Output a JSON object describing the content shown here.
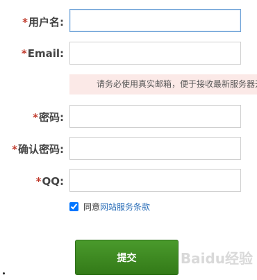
{
  "form": {
    "required_mark": "*",
    "username": {
      "label": "用户名:",
      "value": ""
    },
    "email": {
      "label": "Email:",
      "value": ""
    },
    "hint": "请务必使用真实邮箱，便于接收最新服务器开",
    "password": {
      "label": "密码:",
      "value": ""
    },
    "confirm_password": {
      "label": "确认密码:",
      "value": ""
    },
    "qq": {
      "label": "QQ:",
      "value": ""
    },
    "agree": {
      "prefix": "同意",
      "terms_link": "网站服务条款",
      "checked": true
    },
    "submit_label": "提交"
  },
  "watermark": {
    "text": "Baidu经验"
  },
  "colors": {
    "required": "#c0392b",
    "submit_bg": "#3f8a22",
    "focus_border": "#6fa3d8",
    "hint_bg": "#fbe9e7",
    "link": "#2a6eb8"
  }
}
